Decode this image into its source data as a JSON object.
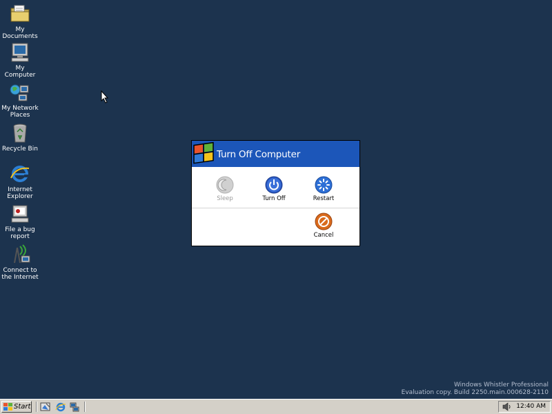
{
  "desktop": {
    "icons": [
      {
        "label": "My Documents",
        "icon": "folder-documents-icon"
      },
      {
        "label": "My Computer",
        "icon": "computer-icon"
      },
      {
        "label": "My Network Places",
        "icon": "network-icon"
      },
      {
        "label": "Recycle Bin",
        "icon": "recycle-bin-icon"
      },
      {
        "label": "Internet Explorer",
        "icon": "internet-explorer-icon"
      },
      {
        "label": "File a bug report",
        "icon": "bug-report-icon"
      },
      {
        "label": "Connect to the Internet",
        "icon": "connect-internet-icon"
      }
    ],
    "watermark": {
      "line1": "Windows Whistler Professional",
      "line2": "Evaluation copy. Build 2250.main.000628-2110"
    }
  },
  "dialog": {
    "title": "Turn Off Computer",
    "options": {
      "sleep": "Sleep",
      "turn_off": "Turn Off",
      "restart": "Restart",
      "cancel": "Cancel"
    },
    "colors": {
      "header": "#1c56b9",
      "turn_off": "#2b59c3",
      "restart": "#2d6fd6",
      "cancel": "#d96a1c",
      "sleep_disabled": "#c8c8c8"
    }
  },
  "taskbar": {
    "start_label": "Start",
    "quick_launch": [
      "desktop-icon",
      "internet-explorer-icon",
      "network-icon"
    ],
    "clock": "12:40 AM"
  },
  "colors": {
    "desktop_bg": "#1c334e",
    "taskbar_bg": "#d4d0c8"
  }
}
